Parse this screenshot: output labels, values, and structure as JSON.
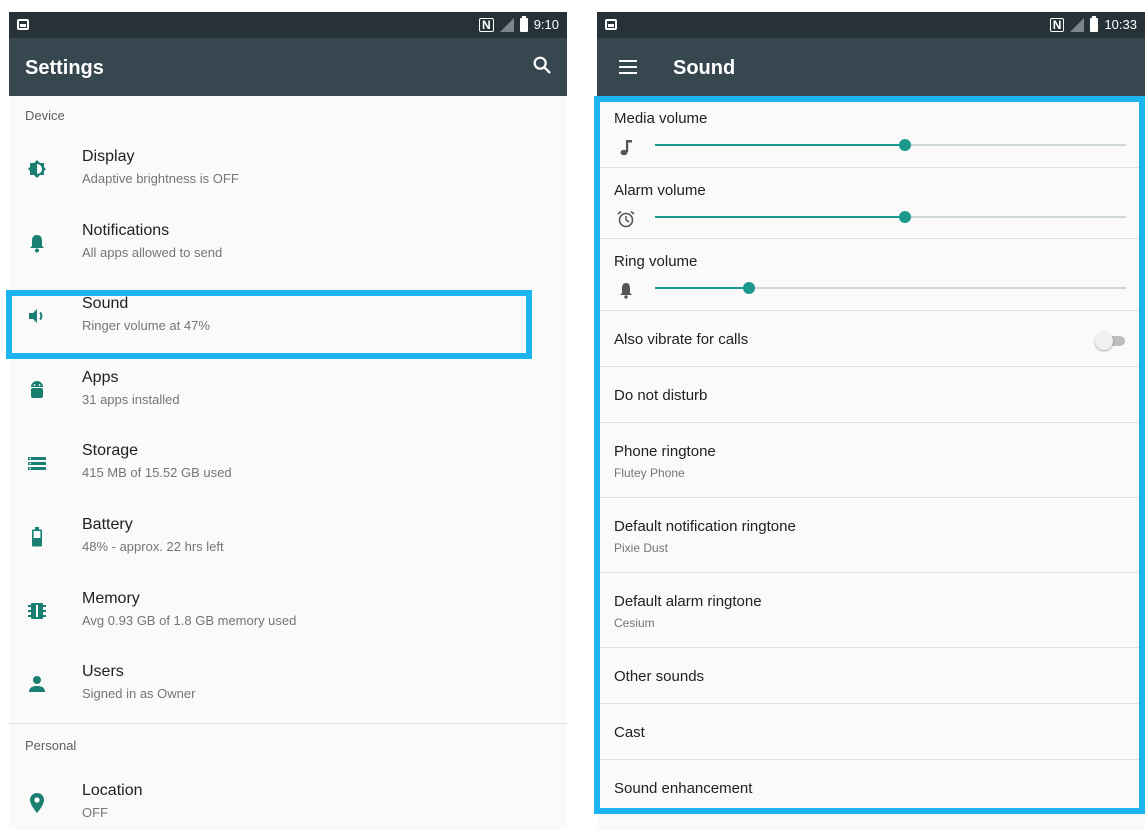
{
  "left_screen": {
    "status_bar": {
      "time": "9:10",
      "nfc_label": "N"
    },
    "toolbar": {
      "title": "Settings",
      "search_icon": "search-icon"
    },
    "section_device": "Device",
    "device_items": [
      {
        "title": "Display",
        "subtitle": "Adaptive brightness is OFF",
        "icon": "brightness-icon"
      },
      {
        "title": "Notifications",
        "subtitle": "All apps allowed to send",
        "icon": "bell-icon"
      },
      {
        "title": "Sound",
        "subtitle": "Ringer volume at 47%",
        "icon": "speaker-icon",
        "highlighted": true
      },
      {
        "title": "Apps",
        "subtitle": "31 apps installed",
        "icon": "android-icon"
      },
      {
        "title": "Storage",
        "subtitle": "415 MB of 15.52 GB used",
        "icon": "storage-icon"
      },
      {
        "title": "Battery",
        "subtitle": "48% - approx. 22 hrs left",
        "icon": "battery-icon"
      },
      {
        "title": "Memory",
        "subtitle": "Avg 0.93 GB of 1.8 GB memory used",
        "icon": "memory-icon"
      },
      {
        "title": "Users",
        "subtitle": "Signed in as Owner",
        "icon": "person-icon"
      }
    ],
    "section_personal": "Personal",
    "personal_items": [
      {
        "title": "Location",
        "subtitle": "OFF",
        "icon": "location-pin-icon"
      }
    ]
  },
  "right_screen": {
    "status_bar": {
      "time": "10:33",
      "nfc_label": "N"
    },
    "toolbar": {
      "title": "Sound",
      "menu_icon": "hamburger-menu-icon"
    },
    "volumes": [
      {
        "label": "Media volume",
        "icon": "music-note-icon",
        "level": 0.53
      },
      {
        "label": "Alarm volume",
        "icon": "alarm-clock-icon",
        "level": 0.53
      },
      {
        "label": "Ring volume",
        "icon": "bell-icon",
        "level": 0.2
      }
    ],
    "vibrate": {
      "label": "Also vibrate for calls",
      "enabled": false
    },
    "do_not_disturb": "Do not disturb",
    "phone_ringtone": {
      "title": "Phone ringtone",
      "value": "Flutey Phone"
    },
    "notification_ringtone": {
      "title": "Default notification ringtone",
      "value": "Pixie Dust"
    },
    "alarm_ringtone": {
      "title": "Default alarm ringtone",
      "value": "Cesium"
    },
    "other_sounds": "Other sounds",
    "cast": "Cast",
    "sound_enhancement": "Sound enhancement"
  },
  "colors": {
    "accent": "#1a9a8c",
    "highlight_border": "#1cb5f0",
    "toolbar": "#37474f",
    "status_bar": "#263238"
  }
}
